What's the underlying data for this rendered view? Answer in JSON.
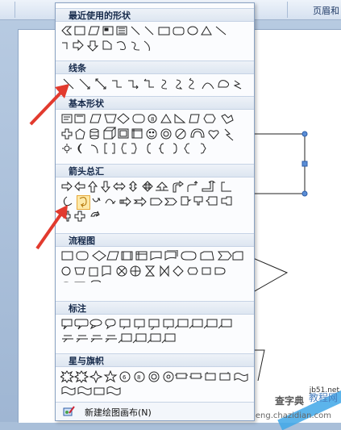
{
  "ribbon": {
    "tab_right": "页眉和"
  },
  "menu": {
    "sections": [
      {
        "title": "最近使用的形状"
      },
      {
        "title": "线条"
      },
      {
        "title": "基本形状"
      },
      {
        "title": "箭头总汇"
      },
      {
        "title": "流程图"
      },
      {
        "title": "标注"
      },
      {
        "title": "星与旗帜"
      }
    ],
    "footer_label": "新建绘图画布(N)"
  },
  "colors": {
    "arrow": "#e23a2e",
    "highlight": "#fde9a8"
  },
  "watermark": {
    "line1": "查字典",
    "line2": "教程网",
    "line3": "jiaocheng.chazidian.com",
    "site": "jb51.net"
  }
}
